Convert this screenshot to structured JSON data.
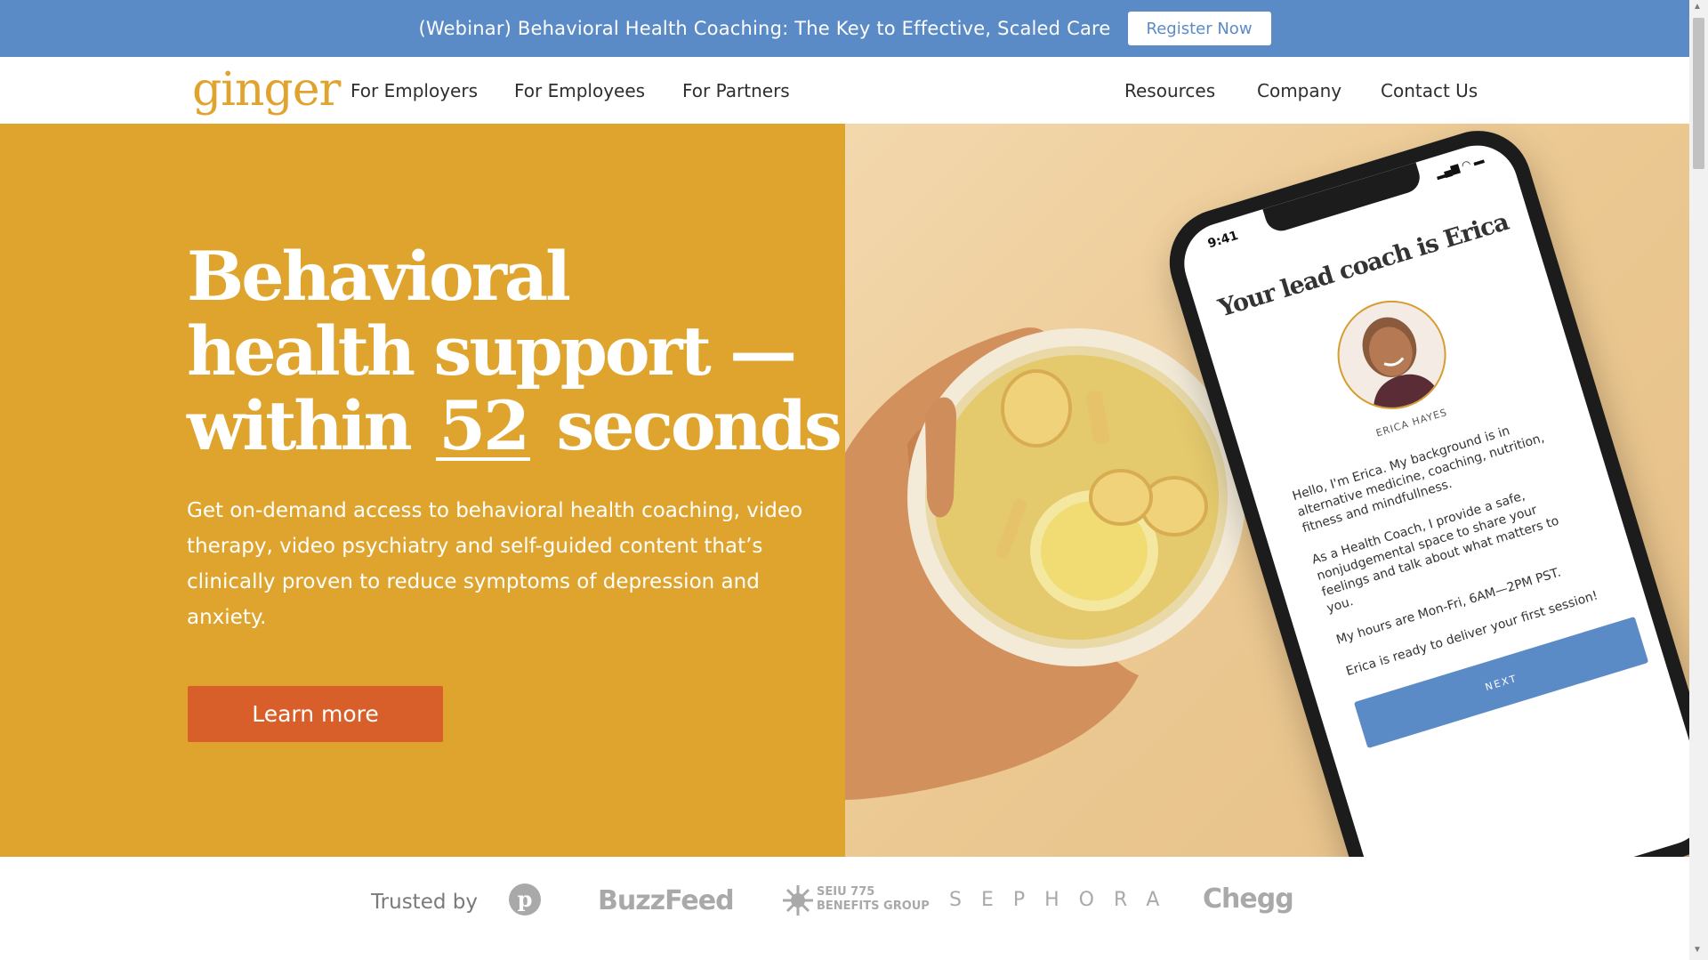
{
  "banner": {
    "text": "(Webinar) Behavioral Health Coaching: The Key to Effective, Scaled Care",
    "button_label": "Register Now"
  },
  "nav": {
    "logo": "ginger",
    "left_links": [
      "For Employers",
      "For Employees",
      "For Partners"
    ],
    "right_links": [
      "Resources",
      "Company",
      "Contact Us"
    ]
  },
  "hero": {
    "headline_line1": "Behavioral",
    "headline_line2": "health support —",
    "headline_within": "within",
    "headline_number": "52",
    "headline_seconds": "seconds",
    "subtext": "Get on-demand access to behavioral health coaching, video therapy, video psychiatry and self-guided content that’s clinically proven to reduce symptoms of depression and anxiety.",
    "cta_label": "Learn more"
  },
  "phone": {
    "time": "9:41",
    "title": "Your lead coach is Erica",
    "coach_name": "ERICA HAYES",
    "bio_1": "Hello, I'm Erica. My background is in alternative medicine, coaching, nutrition, fitness and mindfullness.",
    "bio_2": "As a Health Coach, I provide a safe, nonjudgemental space to share your feelings and talk about what matters to you.",
    "bio_3": "My hours are Mon-Fri, 6AM—2PM PST.",
    "bio_4": "Erica is ready to deliver your first session!",
    "next_label": "NEXT"
  },
  "trusted": {
    "label": "Trusted by",
    "logos": [
      "BuzzFeed",
      "SEIU 775",
      "BENEFITS GROUP",
      "SEPHORA",
      "Chegg"
    ]
  },
  "colors": {
    "banner_blue": "#5a8bc7",
    "brand_gold": "#dfa42e",
    "cta_orange": "#d95f2a"
  }
}
